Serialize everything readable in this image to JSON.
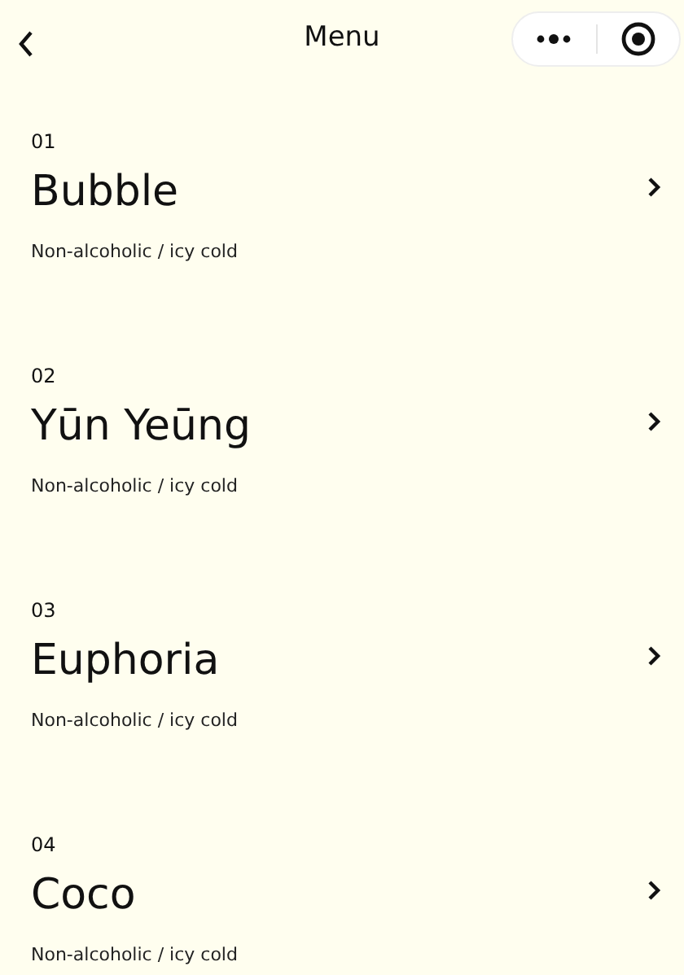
{
  "header": {
    "title": "Menu"
  },
  "items": [
    {
      "number": "01",
      "name": "Bubble",
      "description": "Non-alcoholic / icy cold"
    },
    {
      "number": "02",
      "name": "Yūn Yeūng",
      "description": "Non-alcoholic / icy cold"
    },
    {
      "number": "03",
      "name": "Euphoria",
      "description": "Non-alcoholic / icy cold"
    },
    {
      "number": "04",
      "name": "Coco",
      "description": "Non-alcoholic / icy cold"
    }
  ]
}
